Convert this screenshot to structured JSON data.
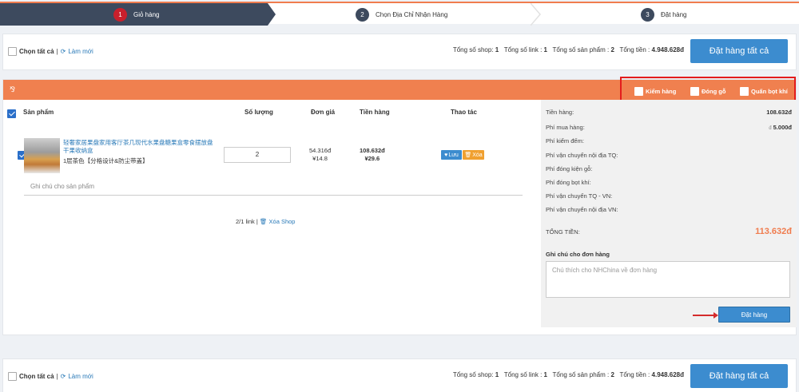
{
  "steps": [
    {
      "num": "1",
      "label": "Giỏ hàng"
    },
    {
      "num": "2",
      "label": "Chọn Địa Chỉ Nhận Hàng"
    },
    {
      "num": "3",
      "label": "Đặt hàng"
    }
  ],
  "topbar": {
    "select_all": "Chọn tất cả",
    "separator": "|",
    "refresh": "Làm mới",
    "shop_label": "Tổng số shop:",
    "shop_count": "1",
    "link_label": "Tổng số link :",
    "link_count": "1",
    "product_label": "Tổng số sản phẩm :",
    "product_count": "2",
    "total_label": "Tổng tiền :",
    "total_value": "4.948.628đ",
    "order_all": "Đặt hàng tất cả"
  },
  "shop": {
    "options": [
      "Kiểm hàng",
      "Đóng gỗ",
      "Quấn bọt khí"
    ],
    "headers": {
      "product": "Sản phẩm",
      "quantity": "Số lượng",
      "unit_price": "Đơn giá",
      "amount": "Tiền hàng",
      "actions": "Thao tác"
    },
    "item": {
      "name": "轻奢家居果盘家用客厅茶几现代水果盘糖果盒零食摆放盘干果收纳盒",
      "variant": "1层茶色【分格设计&防尘带盖】",
      "quantity": "2",
      "unit_price_vnd": "54.316đ",
      "unit_price_cny": "¥14.8",
      "amount_vnd": "108.632đ",
      "amount_cny": "¥29.6",
      "save": "Lưu",
      "delete": "Xóa"
    },
    "note_placeholder": "Ghi chú cho sản phẩm",
    "links_summary": "2/1 link",
    "delete_shop": "Xóa Shop"
  },
  "fees": {
    "rows": [
      {
        "label": "Tiền hàng:",
        "value": "108.632đ"
      },
      {
        "label": "Phí mua hàng:",
        "value": "5.000đ",
        "prefix": "đ"
      },
      {
        "label": "Phí kiểm đếm:",
        "value": ""
      },
      {
        "label": "Phí vận chuyển nội địa TQ:",
        "value": ""
      },
      {
        "label": "Phí đóng kiện gỗ:",
        "value": ""
      },
      {
        "label": "Phí đóng bọt khí:",
        "value": ""
      },
      {
        "label": "Phí vận chuyển TQ - VN:",
        "value": ""
      },
      {
        "label": "Phí vận chuyển nội địa VN:",
        "value": ""
      }
    ],
    "total_label": "TỔNG TIỀN:",
    "total_value": "113.632đ",
    "order_note_label": "Ghi chú cho đơn hàng",
    "order_note_placeholder": "Chú thích cho NHChina về đơn hàng",
    "order_button": "Đặt hàng"
  },
  "colors": {
    "accent_orange": "#f0804f",
    "primary_blue": "#3c8ccf",
    "step_dark": "#3d4a5e",
    "step_active": "#c9202c",
    "highlight_red": "#e31c1c"
  }
}
